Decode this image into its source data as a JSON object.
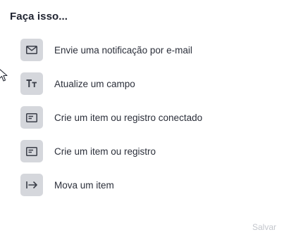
{
  "heading": "Faça isso...",
  "actions": [
    {
      "label": "Envie uma notificação por e-mail",
      "icon": "envelope-icon"
    },
    {
      "label": "Atualize um campo",
      "icon": "text-size-icon"
    },
    {
      "label": "Crie um item ou registro conectado",
      "icon": "card-icon"
    },
    {
      "label": "Crie um item ou registro",
      "icon": "card-icon"
    },
    {
      "label": "Mova um item",
      "icon": "move-arrow-icon"
    }
  ],
  "save_label": "Salvar",
  "colors": {
    "icon_bg": "#d5d7dc",
    "text": "#2b2f3a",
    "heading": "#1f2330",
    "disabled": "#c3c6cc"
  }
}
